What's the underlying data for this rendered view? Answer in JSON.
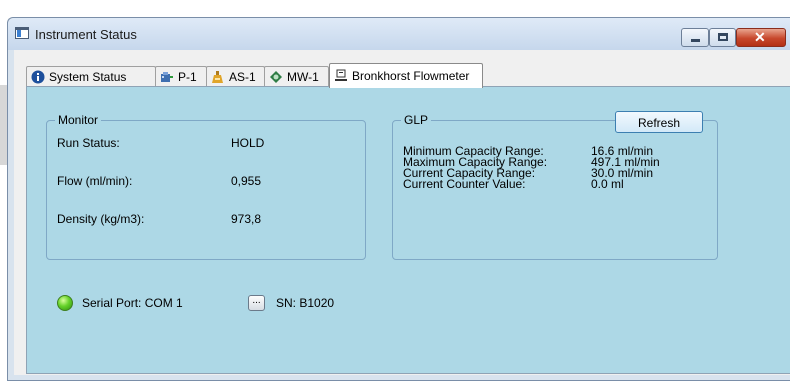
{
  "window": {
    "title": "Instrument Status",
    "close_glyph": "✕"
  },
  "tabs": [
    {
      "label": "System Status",
      "icon": "info-icon"
    },
    {
      "label": "P-1",
      "icon": "pump-icon"
    },
    {
      "label": "AS-1",
      "icon": "autosampler-icon"
    },
    {
      "label": "MW-1",
      "icon": "valve-icon"
    },
    {
      "label": "Bronkhorst Flowmeter",
      "icon": "flowmeter-icon",
      "active": true
    }
  ],
  "monitor": {
    "title": "Monitor",
    "rows": [
      {
        "label": "Run Status:",
        "value": "HOLD"
      },
      {
        "label": "Flow (ml/min):",
        "value": "0,955"
      },
      {
        "label": "Density (kg/m3):",
        "value": "973,8"
      }
    ]
  },
  "glp": {
    "title": "GLP",
    "refresh_label": "Refresh",
    "rows": [
      {
        "label": "Minimum Capacity Range:",
        "value": "16.6 ml/min"
      },
      {
        "label": "Maximum Capacity Range:",
        "value": "497.1 ml/min"
      },
      {
        "label": "Current Capacity Range:",
        "value": "30.0 ml/min"
      },
      {
        "label": "Current Counter Value:",
        "value": "0.0 ml"
      }
    ]
  },
  "connection": {
    "serial_port": "Serial Port:  COM 1",
    "dots": "...",
    "serial_number": "SN:  B1020",
    "status_color": "#66d22a"
  },
  "colors": {
    "panel_background": "#add8e6",
    "title_bar": "#c6d7ec",
    "close_button": "#c7472c"
  }
}
